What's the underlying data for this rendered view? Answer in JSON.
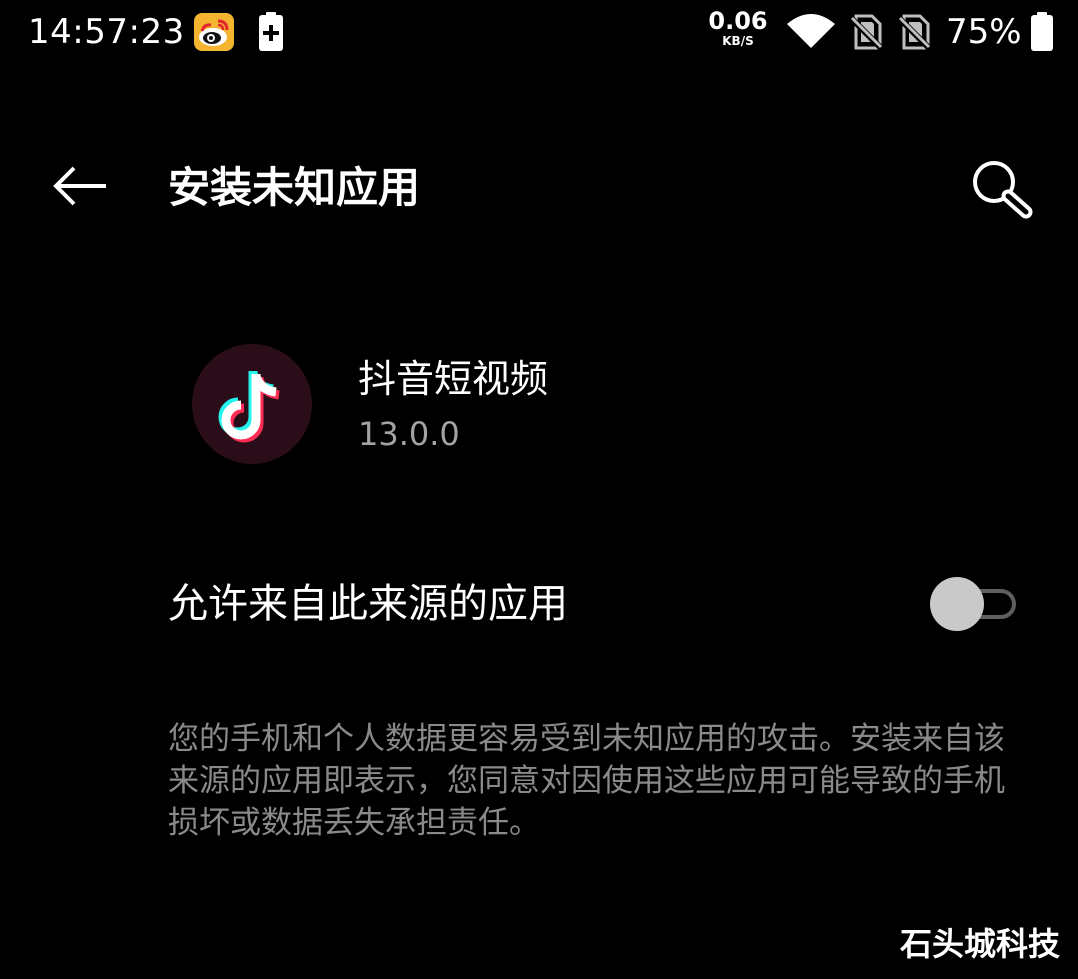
{
  "status_bar": {
    "time": "14:57:23",
    "net_speed_value": "0.06",
    "net_speed_unit": "KB/S",
    "battery_percent": "75%",
    "icons": [
      "weibo-icon",
      "battery-saver-icon",
      "wifi-icon",
      "no-sim-icon",
      "no-sim-icon",
      "battery-icon"
    ]
  },
  "app_bar": {
    "title": "安装未知应用",
    "back_icon": "arrow-left-icon",
    "search_icon": "search-icon"
  },
  "app_info": {
    "name": "抖音短视频",
    "version": "13.0.0",
    "icon": "tiktok-icon"
  },
  "setting": {
    "label": "允许来自此来源的应用",
    "enabled": false
  },
  "warning": {
    "text": "您的手机和个人数据更容易受到未知应用的攻击。安装来自该来源的应用即表示，您同意对因使用这些应用可能导致的手机损坏或数据丢失承担责任。"
  },
  "watermark": {
    "text": "石头城科技"
  },
  "colors": {
    "background": "#000000",
    "primary_text": "#ffffff",
    "secondary_text": "#a3a3a3",
    "hint_text": "#8a8a8a",
    "toggle_thumb_off": "#c9c9c9",
    "toggle_track_off": "#5f5f5f",
    "tiktok_cyan": "#25f4ee",
    "tiktok_red": "#fe2c55",
    "tiktok_bg": "#2a0d18"
  }
}
